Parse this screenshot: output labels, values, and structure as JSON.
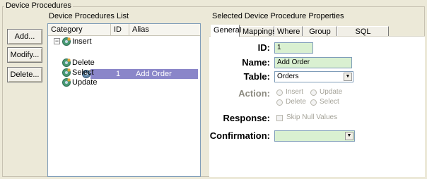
{
  "group": {
    "title": "Device Procedures"
  },
  "buttons": {
    "add": "Add...",
    "modify": "Modify...",
    "delete": "Delete..."
  },
  "list": {
    "title": "Device Procedures List",
    "columns": [
      "Category",
      "ID",
      "Alias"
    ],
    "expander": "−",
    "tree": [
      {
        "label": "Insert",
        "icon": "gear-icon",
        "expanded": true
      },
      {
        "label": "Delete",
        "icon": "gear-icon"
      },
      {
        "label": "Select",
        "icon": "gear-icon"
      },
      {
        "label": "Update",
        "icon": "gear-icon"
      }
    ],
    "selected_row": {
      "id": "1",
      "alias": "Add Order",
      "icon": "gear-icon"
    }
  },
  "properties": {
    "title": "Selected Device Procedure Properties",
    "tabs": [
      "General",
      "Mappings",
      "Where",
      "Group By",
      "SQL Statement"
    ],
    "active_tab": "General",
    "id_label": "ID:",
    "id_value": "1",
    "name_label": "Name:",
    "name_value": "Add Order",
    "table_label": "Table:",
    "table_value": "Orders",
    "action_label": "Action:",
    "actions": [
      "Insert",
      "Update",
      "Delete",
      "Select"
    ],
    "response_label": "Response:",
    "response_checkbox": "Skip Null Values",
    "confirmation_label": "Confirmation:",
    "confirmation_value": ""
  },
  "colors": {
    "selection": "#8a86c9",
    "field_bg": "#d9f0d1",
    "dialog_bg": "#ece9d8"
  }
}
